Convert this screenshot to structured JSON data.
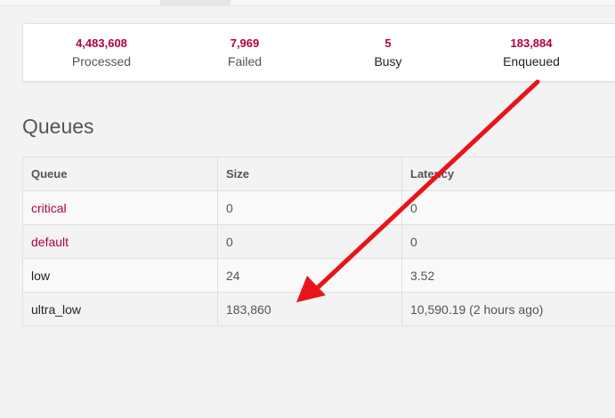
{
  "summary": {
    "processed": {
      "value": "4,483,608",
      "label": "Processed"
    },
    "failed": {
      "value": "7,969",
      "label": "Failed"
    },
    "busy": {
      "value": "5",
      "label": "Busy"
    },
    "enqueued": {
      "value": "183,884",
      "label": "Enqueued"
    }
  },
  "queues": {
    "title": "Queues",
    "headers": {
      "queue": "Queue",
      "size": "Size",
      "latency": "Latency"
    },
    "rows": [
      {
        "name": "critical",
        "size": "0",
        "latency": "0"
      },
      {
        "name": "default",
        "size": "0",
        "latency": "0"
      },
      {
        "name": "low",
        "size": "24",
        "latency": "3.52"
      },
      {
        "name": "ultra_low",
        "size": "183,860",
        "latency": "10,590.19 (2 hours ago)"
      }
    ]
  },
  "colors": {
    "accent": "#b1003e",
    "annotation_arrow": "#e8141a"
  }
}
